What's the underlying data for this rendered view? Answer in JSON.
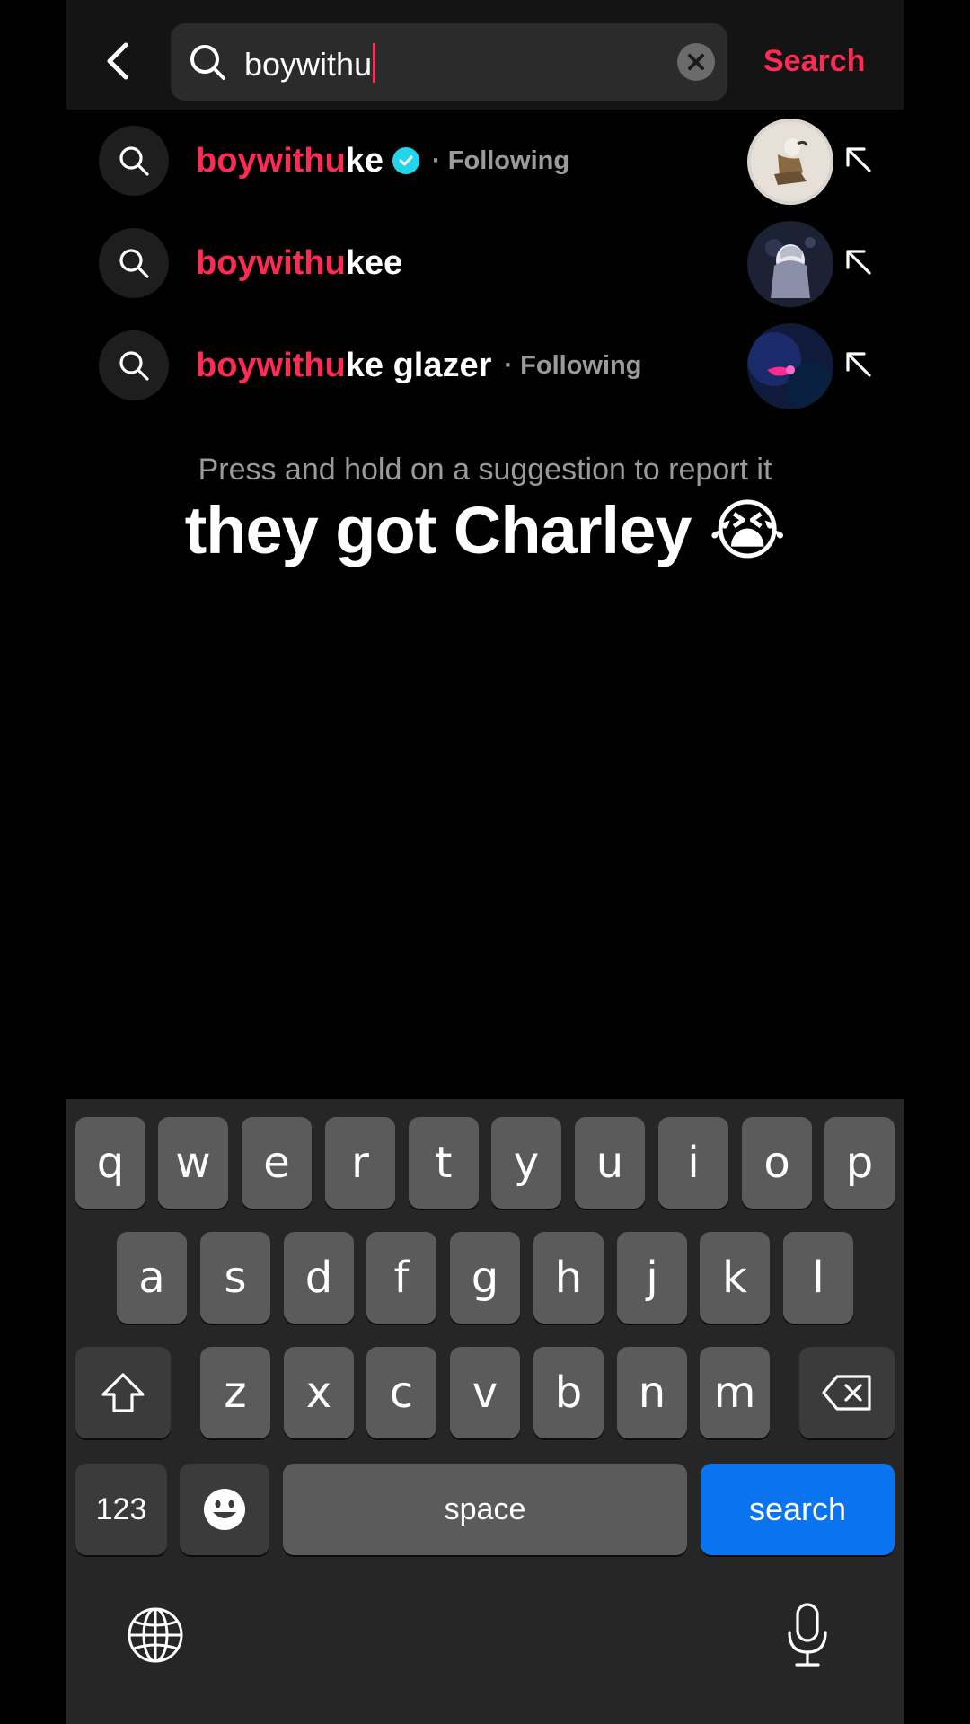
{
  "header": {
    "query": "boywithu",
    "search_label": "Search"
  },
  "suggestions": [
    {
      "highlight": "boywithu",
      "rest": "ke",
      "verified": true,
      "meta": "· Following"
    },
    {
      "highlight": "boywithu",
      "rest": "kee",
      "verified": false,
      "meta": ""
    },
    {
      "highlight": "boywithu",
      "rest": "ke glazer",
      "verified": false,
      "meta": "· Following"
    }
  ],
  "hint": "Press and hold on a suggestion to report it",
  "caption": "they got Charley 😭",
  "keyboard": {
    "row1": [
      "q",
      "w",
      "e",
      "r",
      "t",
      "y",
      "u",
      "i",
      "o",
      "p"
    ],
    "row2": [
      "a",
      "s",
      "d",
      "f",
      "g",
      "h",
      "j",
      "k",
      "l"
    ],
    "row3": [
      "z",
      "x",
      "c",
      "v",
      "b",
      "n",
      "m"
    ],
    "numbers_label": "123",
    "space_label": "space",
    "search_label": "search"
  },
  "colors": {
    "accent": "#fe2c55",
    "verified": "#20d5ec",
    "keyboard_action": "#0a74f0"
  }
}
